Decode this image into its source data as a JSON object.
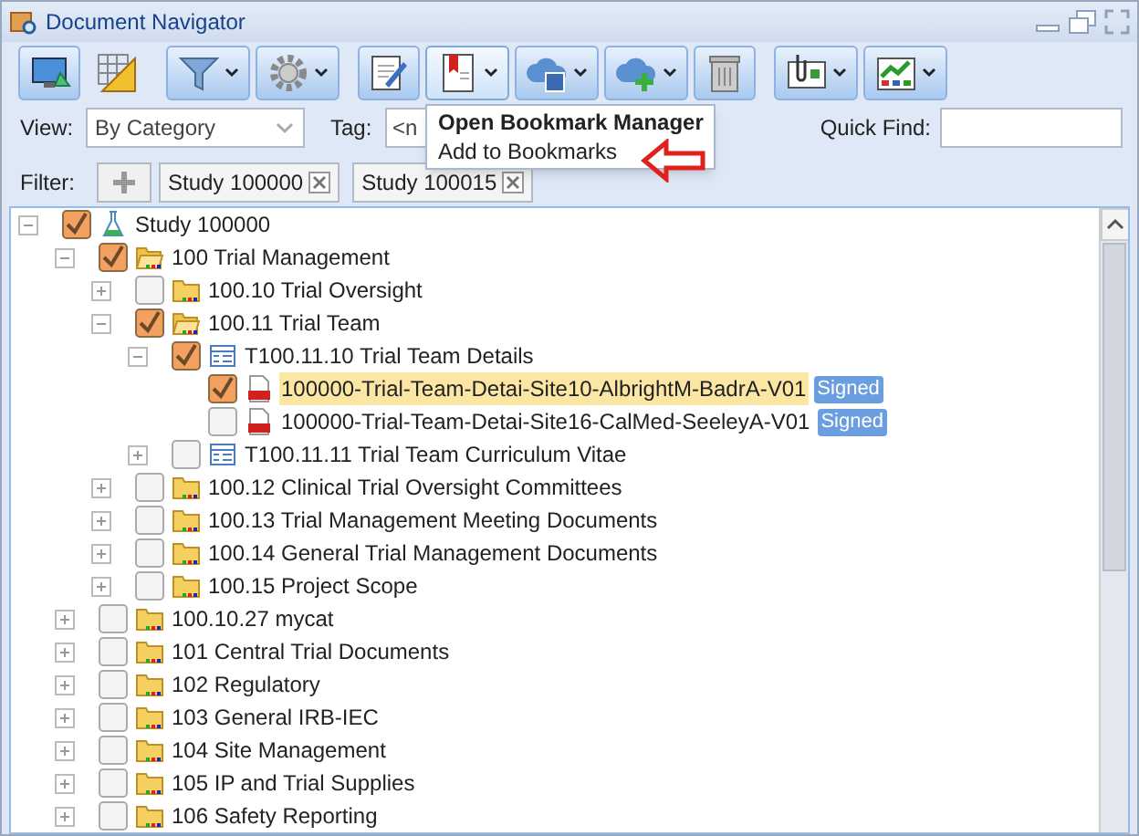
{
  "window": {
    "title": "Document Navigator"
  },
  "toolbar": [
    [
      {
        "kind": "monitor",
        "dropdown": false,
        "framed": true,
        "active": false
      },
      {
        "kind": "grid",
        "dropdown": false,
        "framed": false,
        "active": false
      }
    ],
    [
      {
        "kind": "funnel",
        "dropdown": true,
        "framed": true,
        "active": false
      },
      {
        "kind": "gear",
        "dropdown": true,
        "framed": true,
        "active": false
      }
    ],
    [
      {
        "kind": "edit",
        "dropdown": false,
        "framed": true,
        "active": false
      },
      {
        "kind": "bookmark",
        "dropdown": true,
        "framed": true,
        "active": true
      },
      {
        "kind": "cloud-save",
        "dropdown": true,
        "framed": true,
        "active": false
      },
      {
        "kind": "cloud-add",
        "dropdown": true,
        "framed": true,
        "active": false
      },
      {
        "kind": "trash",
        "dropdown": false,
        "framed": true,
        "active": false
      }
    ],
    [
      {
        "kind": "clip",
        "dropdown": true,
        "framed": true,
        "active": false
      },
      {
        "kind": "chart",
        "dropdown": true,
        "framed": true,
        "active": false
      }
    ]
  ],
  "view": {
    "label": "View:",
    "value": "By Category"
  },
  "tag": {
    "label": "Tag:",
    "value": "<n"
  },
  "quick_find": {
    "label": "Quick Find:"
  },
  "filter": {
    "label": "Filter:",
    "chips": [
      "Study 100000",
      "Study 100015"
    ]
  },
  "menu": {
    "items": [
      {
        "label": "Open Bookmark Manager",
        "bold": true
      },
      {
        "label": "Add to Bookmarks",
        "bold": false
      }
    ]
  },
  "tree": [
    {
      "label": "Study 100000",
      "kind": "study",
      "checked": true,
      "expanded": true,
      "children": [
        {
          "label": "100 Trial Management",
          "kind": "folder-open",
          "checked": true,
          "expanded": true,
          "children": [
            {
              "label": "100.10 Trial Oversight",
              "kind": "folder",
              "checked": false,
              "expanded": false
            },
            {
              "label": "100.11 Trial Team",
              "kind": "folder-open",
              "checked": true,
              "expanded": true,
              "children": [
                {
                  "label": "T100.11.10 Trial Team Details",
                  "kind": "section",
                  "checked": true,
                  "expanded": true,
                  "children": [
                    {
                      "label": "100000-Trial-Team-Detai-Site10-AlbrightM-BadrA-V01",
                      "kind": "pdf",
                      "checked": true,
                      "selected": true,
                      "badge": "Signed"
                    },
                    {
                      "label": "100000-Trial-Team-Detai-Site16-CalMed-SeeleyA-V01",
                      "kind": "pdf",
                      "checked": false,
                      "selected": false,
                      "badge": "Signed"
                    }
                  ]
                },
                {
                  "label": "T100.11.11 Trial Team Curriculum Vitae",
                  "kind": "section",
                  "checked": false,
                  "expanded": false
                }
              ]
            },
            {
              "label": "100.12 Clinical Trial Oversight Committees",
              "kind": "folder",
              "checked": false,
              "expanded": false
            },
            {
              "label": "100.13 Trial Management Meeting Documents",
              "kind": "folder",
              "checked": false,
              "expanded": false
            },
            {
              "label": "100.14 General Trial Management Documents",
              "kind": "folder",
              "checked": false,
              "expanded": false
            },
            {
              "label": "100.15 Project Scope",
              "kind": "folder",
              "checked": false,
              "expanded": false
            }
          ]
        },
        {
          "label": "100.10.27 mycat",
          "kind": "folder",
          "checked": false,
          "expanded": false
        },
        {
          "label": "101 Central Trial Documents",
          "kind": "folder",
          "checked": false,
          "expanded": false
        },
        {
          "label": "102 Regulatory",
          "kind": "folder",
          "checked": false,
          "expanded": false
        },
        {
          "label": "103 General IRB-IEC",
          "kind": "folder",
          "checked": false,
          "expanded": false
        },
        {
          "label": "104 Site Management",
          "kind": "folder",
          "checked": false,
          "expanded": false
        },
        {
          "label": "105 IP and Trial Supplies",
          "kind": "folder",
          "checked": false,
          "expanded": false
        },
        {
          "label": "106 Safety Reporting",
          "kind": "folder",
          "checked": false,
          "expanded": false
        }
      ]
    }
  ]
}
